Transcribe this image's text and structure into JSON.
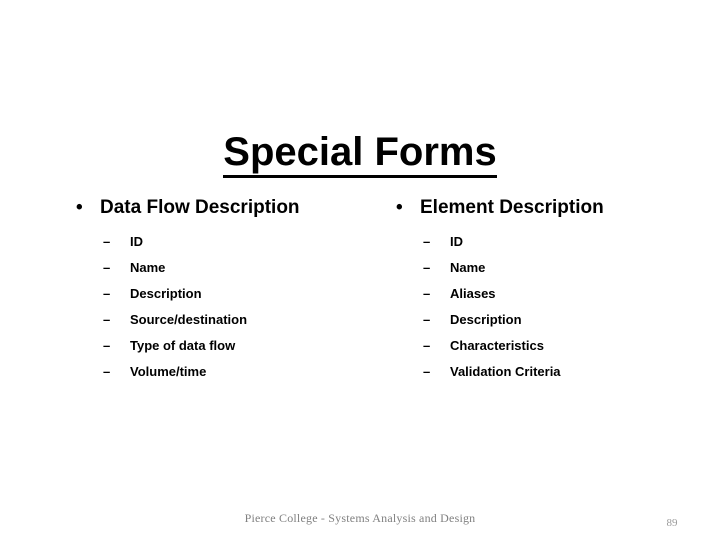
{
  "slide": {
    "title": "Special Forms",
    "bullet_glyph": "•",
    "dash_glyph": "–",
    "columns": [
      {
        "heading": "Data Flow Description",
        "items": [
          "ID",
          "Name",
          "Description",
          "Source/destination",
          "Type of data flow",
          "Volume/time"
        ]
      },
      {
        "heading": "Element Description",
        "items": [
          "ID",
          "Name",
          "Aliases",
          "Description",
          "Characteristics",
          "Validation Criteria"
        ]
      }
    ],
    "footer": "Pierce College - Systems Analysis and Design",
    "page_number": "89",
    "colors": {
      "background": "#ffffff",
      "text": "#000000",
      "footer_text": "#808080",
      "page_number_text": "#9a9a9a"
    }
  }
}
